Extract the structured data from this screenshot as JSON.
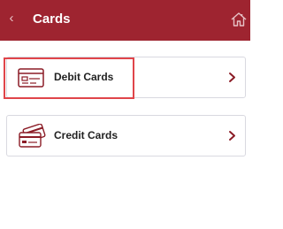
{
  "header": {
    "title": "Cards",
    "back_icon": "chevron-left-icon",
    "home_icon": "home-icon",
    "background_color": "#9e2430"
  },
  "cards": [
    {
      "label": "Debit Cards",
      "icon": "debit-card-icon",
      "selected": true
    },
    {
      "label": "Credit Cards",
      "icon": "credit-cards-icon",
      "selected": false
    }
  ],
  "accent_color": "#8b1c26",
  "selection_color": "#e0454a"
}
